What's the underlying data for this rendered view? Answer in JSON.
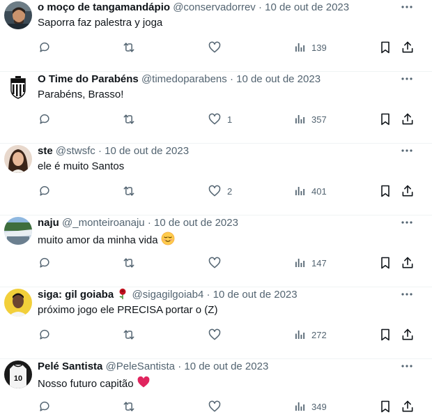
{
  "tweets": [
    {
      "name": "o moço de tangamandápio",
      "handle": "@conservadorrev",
      "separator": "·",
      "date": "10 de out de 2023",
      "text": "Saporra faz palestra y joga",
      "emoji": "",
      "reply_count": "",
      "retweet_count": "",
      "like_count": "",
      "views": "139",
      "avatar": "avatar-man-photo"
    },
    {
      "name": "O Time do Parabéns",
      "handle": "@timedoparabens",
      "separator": "·",
      "date": "10 de out de 2023",
      "text": "Parabéns, Brasso!",
      "emoji": "",
      "reply_count": "",
      "retweet_count": "",
      "like_count": "1",
      "views": "357",
      "avatar": "santos-crest-logo"
    },
    {
      "name": "ste",
      "handle": "@stwsfc",
      "separator": "·",
      "date": "10 de out de 2023",
      "text": "ele é muito Santos",
      "emoji": "",
      "reply_count": "",
      "retweet_count": "",
      "like_count": "2",
      "views": "401",
      "avatar": "avatar-woman-photo"
    },
    {
      "name": "naju",
      "handle": "@_monteiroanaju",
      "separator": "·",
      "date": "10 de out de 2023",
      "text": "muito amor da minha vida",
      "emoji": "relieved-face",
      "reply_count": "",
      "retweet_count": "",
      "like_count": "",
      "views": "147",
      "avatar": "avatar-stadium-photo"
    },
    {
      "name": "siga: gil goiaba",
      "name_emoji": "rose",
      "handle": "@sigagilgoiab4",
      "separator": "·",
      "date": "10 de out de 2023",
      "text": "próximo jogo ele PRECISA portar o (Z)",
      "emoji": "",
      "reply_count": "",
      "retweet_count": "",
      "like_count": "",
      "views": "272",
      "avatar": "avatar-player-photo"
    },
    {
      "name": "Pelé Santista",
      "handle": "@PeleSantista",
      "separator": "·",
      "date": "10 de out de 2023",
      "text": "Nosso futuro capitão",
      "emoji": "red-heart",
      "reply_count": "",
      "retweet_count": "",
      "like_count": "",
      "views": "349",
      "avatar": "avatar-jersey-10"
    }
  ],
  "avatar_jersey_number": "10",
  "colors": {
    "text": "#0f1419",
    "secondary": "#536471",
    "divider": "#eff3f4",
    "heart": "#e0245e"
  }
}
